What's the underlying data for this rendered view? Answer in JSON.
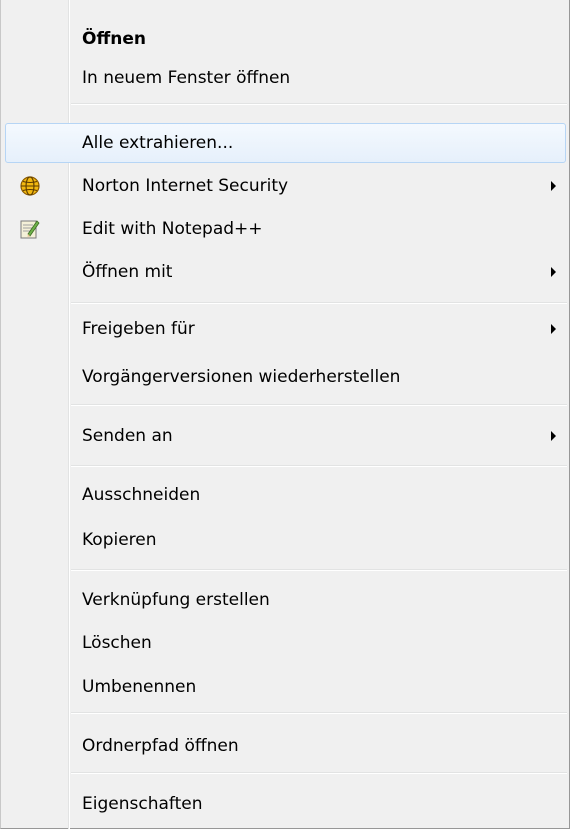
{
  "menu": {
    "items": [
      {
        "label": "Öffnen",
        "bold": true,
        "submenu": false
      },
      {
        "label": "In neuem Fenster öffnen",
        "submenu": false
      },
      {
        "label": "Alle extrahieren...",
        "submenu": false,
        "highlighted": true
      },
      {
        "label": "Norton Internet Security",
        "submenu": true,
        "icon": "norton-globe-icon"
      },
      {
        "label": "Edit with Notepad++",
        "submenu": false,
        "icon": "notepad-plus-plus-icon"
      },
      {
        "label": "Öffnen mit",
        "submenu": true
      },
      {
        "label": "Freigeben für",
        "submenu": true
      },
      {
        "label": "Vorgängerversionen wiederherstellen",
        "submenu": false
      },
      {
        "label": "Senden an",
        "submenu": true
      },
      {
        "label": "Ausschneiden",
        "submenu": false
      },
      {
        "label": "Kopieren",
        "submenu": false
      },
      {
        "label": "Verknüpfung erstellen",
        "submenu": false
      },
      {
        "label": "Löschen",
        "submenu": false
      },
      {
        "label": "Umbenennen",
        "submenu": false
      },
      {
        "label": "Ordnerpfad öffnen",
        "submenu": false
      },
      {
        "label": "Eigenschaften",
        "submenu": false
      }
    ]
  },
  "colors": {
    "menu_background": "#f0f0f0",
    "highlight_border": "#b6d5f5",
    "highlight_fill": "#e6f0fb",
    "separator": "#e2e3e3"
  }
}
